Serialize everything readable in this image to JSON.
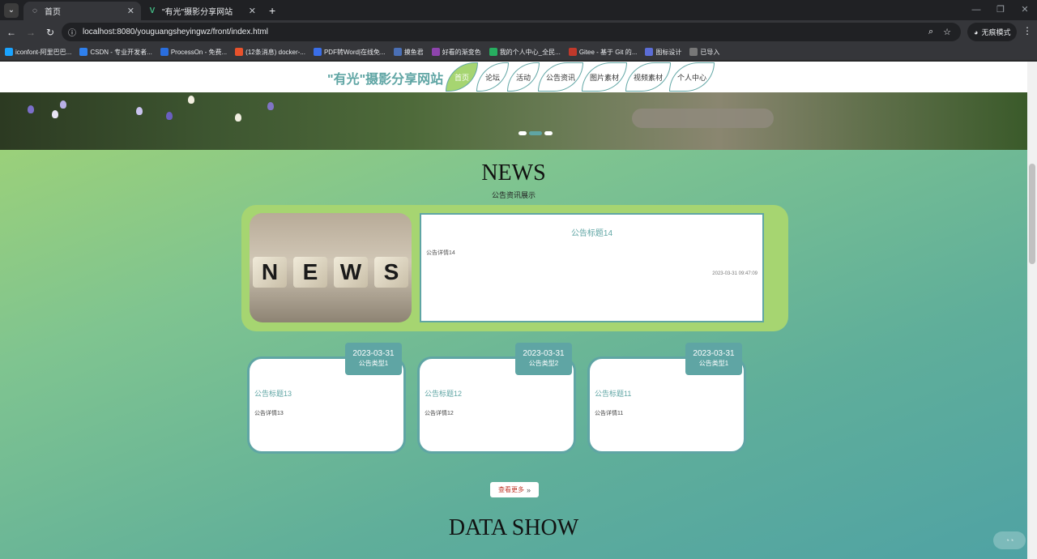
{
  "browser": {
    "tabs": [
      {
        "title": "首页",
        "active": true
      },
      {
        "title": "\"有光\"摄影分享网站",
        "active": false
      }
    ],
    "url": "localhost:8080/youguangsheyingwz/front/index.html",
    "incognito_label": "无痕模式",
    "bookmarks": [
      {
        "label": "iconfont-阿里巴巴...",
        "color": "#1aa3ff"
      },
      {
        "label": "CSDN - 专业开发者...",
        "color": "#2f80ed"
      },
      {
        "label": "ProcessOn - 免费...",
        "color": "#2a6ede"
      },
      {
        "label": "(12条消息) docker-...",
        "color": "#e8522c"
      },
      {
        "label": "PDF转Word|在线免...",
        "color": "#3a6ee8"
      },
      {
        "label": "摸鱼君",
        "color": "#4a6fb5"
      },
      {
        "label": "好看的渐变色",
        "color": "#8e44ad"
      },
      {
        "label": "我的个人中心_全民...",
        "color": "#27ae60"
      },
      {
        "label": "Gitee - 基于 Git 的...",
        "color": "#c0392b"
      },
      {
        "label": "图标设计",
        "color": "#5b6dd6"
      },
      {
        "label": "已导入",
        "color": "#777777"
      }
    ]
  },
  "site": {
    "title": "\"有光\"摄影分享网站",
    "nav": [
      "首页",
      "论坛",
      "活动",
      "公告资讯",
      "图片素材",
      "视频素材",
      "个人中心"
    ]
  },
  "news": {
    "title": "NEWS",
    "subtitle": "公告资讯展示",
    "featured": {
      "title": "公告标题14",
      "detail": "公告详情14",
      "time": "2023-03-31 09:47:09",
      "image_letters": [
        "N",
        "E",
        "W",
        "S"
      ]
    },
    "cards": [
      {
        "date": "2023-03-31",
        "type": "公告类型1",
        "title": "公告标题13",
        "detail": "公告详情13"
      },
      {
        "date": "2023-03-31",
        "type": "公告类型2",
        "title": "公告标题12",
        "detail": "公告详情12"
      },
      {
        "date": "2023-03-31",
        "type": "公告类型1",
        "title": "公告标题11",
        "detail": "公告详情11"
      }
    ],
    "more_label": "查看更多"
  },
  "data_show": {
    "title": "DATA SHOW"
  },
  "colors": {
    "accent": "#5fa5a4",
    "green": "#a6d571"
  }
}
